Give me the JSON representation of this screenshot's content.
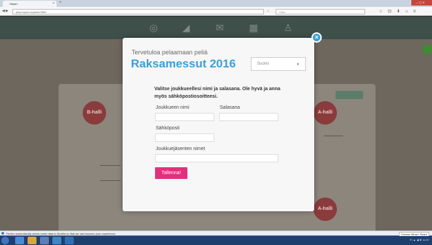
{
  "browser": {
    "tab_title": "Nayan",
    "tab_close": "×",
    "new_tab": "+",
    "url": "play.nayan.io/game/3681",
    "search_placeholder": "Haku",
    "nav_arrows": "◀ ▶",
    "reload": "C",
    "toolbar_icons": "☆ ⊡ ⬇ ⌂ ≡",
    "window_controls": "— ▢ ✕"
  },
  "modal": {
    "welcome": "Tervetuloa pelaamaan peliä",
    "title": "Raksamessut 2016",
    "language": "Suomi",
    "language_arrow": "▼",
    "instructions": "Valitse joukkueellesi nimi ja salasana. Ole hyvä ja anna myös sähköpostiosoitteesi.",
    "team_name_label": "Joukkueen nimi",
    "password_label": "Salasana",
    "email_label": "Sähköposti",
    "members_label": "Joukkuejäsenten nimet",
    "submit_label": "Tallenna!",
    "close": "×"
  },
  "background": {
    "bubble_left": "B-halli",
    "bubble_right": "A-halli"
  },
  "notice": {
    "text": "Firefox automatically sends some data to Mozilla so that we can improve your experience.",
    "button": "Choose What I Share"
  },
  "taskbar": {
    "tray": "FI  ▲  ◀  ⊞  11:57"
  },
  "colors": {
    "accent_blue": "#3a9fd6",
    "button_pink": "#e3307d",
    "header_dark": "#3f4f4a"
  }
}
